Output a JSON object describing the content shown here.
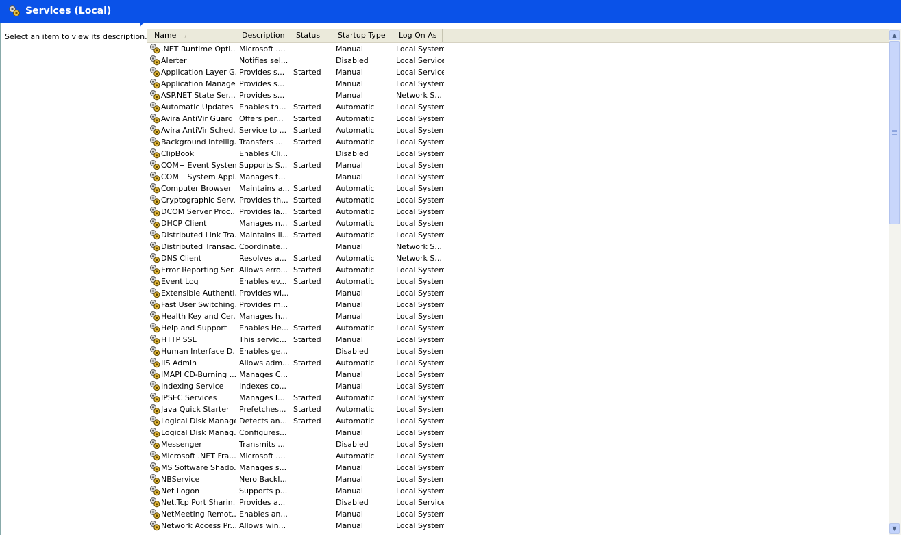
{
  "window": {
    "title": "Services (Local)"
  },
  "left_pane": {
    "description": "Select an item to view its description."
  },
  "columns": [
    {
      "label": "Name",
      "sorted": true
    },
    {
      "label": "Description"
    },
    {
      "label": "Status"
    },
    {
      "label": "Startup Type"
    },
    {
      "label": "Log On As"
    }
  ],
  "sort_indicator": "/",
  "rows": [
    [
      ".NET Runtime Opti...",
      "Microsoft ....",
      "",
      "Manual",
      "Local System"
    ],
    [
      "Alerter",
      "Notifies sel...",
      "",
      "Disabled",
      "Local Service"
    ],
    [
      "Application Layer G...",
      "Provides s...",
      "Started",
      "Manual",
      "Local Service"
    ],
    [
      "Application Manage...",
      "Provides s...",
      "",
      "Manual",
      "Local System"
    ],
    [
      "ASP.NET State Ser...",
      "Provides s...",
      "",
      "Manual",
      "Network S..."
    ],
    [
      "Automatic Updates",
      "Enables th...",
      "Started",
      "Automatic",
      "Local System"
    ],
    [
      "Avira AntiVir Guard",
      "Offers per...",
      "Started",
      "Automatic",
      "Local System"
    ],
    [
      "Avira AntiVir Sched...",
      "Service to ...",
      "Started",
      "Automatic",
      "Local System"
    ],
    [
      "Background Intellig...",
      "Transfers ...",
      "Started",
      "Automatic",
      "Local System"
    ],
    [
      "ClipBook",
      "Enables Cli...",
      "",
      "Disabled",
      "Local System"
    ],
    [
      "COM+ Event System",
      "Supports S...",
      "Started",
      "Manual",
      "Local System"
    ],
    [
      "COM+ System Appl...",
      "Manages t...",
      "",
      "Manual",
      "Local System"
    ],
    [
      "Computer Browser",
      "Maintains a...",
      "Started",
      "Automatic",
      "Local System"
    ],
    [
      "Cryptographic Serv...",
      "Provides th...",
      "Started",
      "Automatic",
      "Local System"
    ],
    [
      "DCOM Server Proc...",
      "Provides la...",
      "Started",
      "Automatic",
      "Local System"
    ],
    [
      "DHCP Client",
      "Manages n...",
      "Started",
      "Automatic",
      "Local System"
    ],
    [
      "Distributed Link Tra...",
      "Maintains li...",
      "Started",
      "Automatic",
      "Local System"
    ],
    [
      "Distributed Transac...",
      "Coordinate...",
      "",
      "Manual",
      "Network S..."
    ],
    [
      "DNS Client",
      "Resolves a...",
      "Started",
      "Automatic",
      "Network S..."
    ],
    [
      "Error Reporting Ser...",
      "Allows erro...",
      "Started",
      "Automatic",
      "Local System"
    ],
    [
      "Event Log",
      "Enables ev...",
      "Started",
      "Automatic",
      "Local System"
    ],
    [
      "Extensible Authenti...",
      "Provides wi...",
      "",
      "Manual",
      "Local System"
    ],
    [
      "Fast User Switching...",
      "Provides m...",
      "",
      "Manual",
      "Local System"
    ],
    [
      "Health Key and Cer...",
      "Manages h...",
      "",
      "Manual",
      "Local System"
    ],
    [
      "Help and Support",
      "Enables He...",
      "Started",
      "Automatic",
      "Local System"
    ],
    [
      "HTTP SSL",
      "This servic...",
      "Started",
      "Manual",
      "Local System"
    ],
    [
      "Human Interface D...",
      "Enables ge...",
      "",
      "Disabled",
      "Local System"
    ],
    [
      "IIS Admin",
      "Allows adm...",
      "Started",
      "Automatic",
      "Local System"
    ],
    [
      "IMAPI CD-Burning ...",
      "Manages C...",
      "",
      "Manual",
      "Local System"
    ],
    [
      "Indexing Service",
      "Indexes co...",
      "",
      "Manual",
      "Local System"
    ],
    [
      "IPSEC Services",
      "Manages I...",
      "Started",
      "Automatic",
      "Local System"
    ],
    [
      "Java Quick Starter",
      "Prefetches...",
      "Started",
      "Automatic",
      "Local System"
    ],
    [
      "Logical Disk Manager",
      "Detects an...",
      "Started",
      "Automatic",
      "Local System"
    ],
    [
      "Logical Disk Manag...",
      "Configures...",
      "",
      "Manual",
      "Local System"
    ],
    [
      "Messenger",
      "Transmits ...",
      "",
      "Disabled",
      "Local System"
    ],
    [
      "Microsoft .NET Fra...",
      "Microsoft ....",
      "",
      "Automatic",
      "Local System"
    ],
    [
      "MS Software Shado...",
      "Manages s...",
      "",
      "Manual",
      "Local System"
    ],
    [
      "NBService",
      "Nero BackI...",
      "",
      "Manual",
      "Local System"
    ],
    [
      "Net Logon",
      "Supports p...",
      "",
      "Manual",
      "Local System"
    ],
    [
      "Net.Tcp Port Sharin...",
      "Provides a...",
      "",
      "Disabled",
      "Local Service"
    ],
    [
      "NetMeeting Remot...",
      "Enables an...",
      "",
      "Manual",
      "Local System"
    ],
    [
      "Network Access Pr...",
      "Allows win...",
      "",
      "Manual",
      "Local System"
    ]
  ],
  "icons": {
    "title": "gears-icon",
    "row": "gears-icon"
  },
  "colors": {
    "titlebar": "#0a52e8",
    "header": "#ebeadb",
    "scroll": "#c2d3fc"
  }
}
